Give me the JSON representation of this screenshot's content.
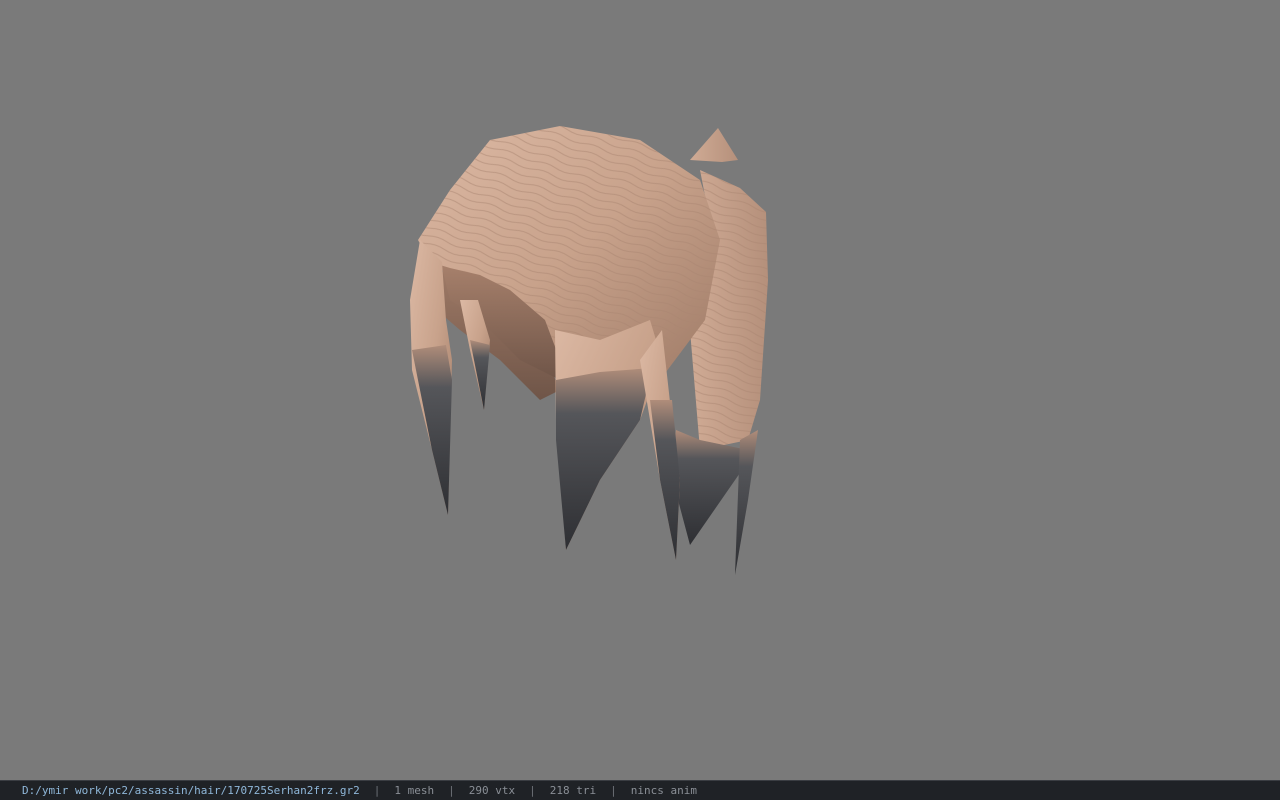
{
  "viewer": {
    "background_color": "#7a7a7a",
    "model": {
      "subject": "hair-mesh",
      "base_color": "#c9a48e",
      "tip_color": "#3c3d40"
    }
  },
  "status_bar": {
    "file_path": "D:/ymir work/pc2/assassin/hair/170725Serhan2frz.gr2",
    "mesh_count": "1 mesh",
    "vertex_count": "290 vtx",
    "triangle_count": "218 tri",
    "animation": "nincs anim",
    "separator": "|"
  }
}
